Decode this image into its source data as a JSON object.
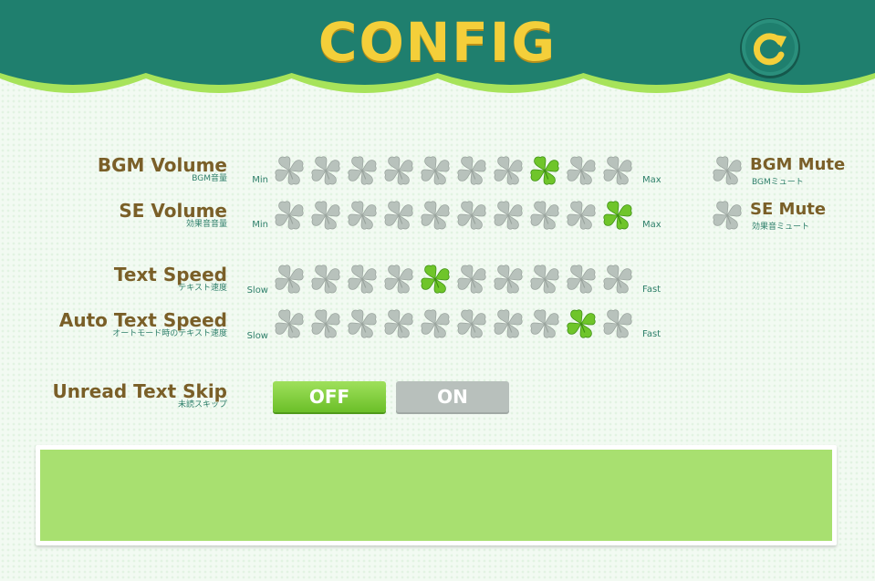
{
  "header": {
    "title": "CONFIG",
    "back_icon": "refresh-arrow-icon",
    "colors": {
      "band": "#1f7f6e",
      "trim": "#a7e35a",
      "title": "#f4cf3a"
    }
  },
  "settings": {
    "bgm_volume": {
      "label": "BGM Volume",
      "sublabel": "BGM音量",
      "min_label": "Min",
      "max_label": "Max",
      "selected": 8,
      "steps": 10
    },
    "se_volume": {
      "label": "SE Volume",
      "sublabel": "効果音音量",
      "min_label": "Min",
      "max_label": "Max",
      "selected": 10,
      "steps": 10
    },
    "text_speed": {
      "label": "Text Speed",
      "sublabel": "テキスト速度",
      "min_label": "Slow",
      "max_label": "Fast",
      "selected": 5,
      "steps": 10
    },
    "auto_text_speed": {
      "label": "Auto Text Speed",
      "sublabel": "オートモード時のテキスト速度",
      "min_label": "Slow",
      "max_label": "Fast",
      "selected": 9,
      "steps": 10
    },
    "unread_text_skip": {
      "label": "Unread Text Skip",
      "sublabel": "未読スキップ",
      "off_label": "OFF",
      "on_label": "ON",
      "value": "OFF"
    }
  },
  "mutes": {
    "bgm": {
      "label": "BGM Mute",
      "sublabel": "BGMミュート",
      "active": false
    },
    "se": {
      "label": "SE Mute",
      "sublabel": "効果音ミュート",
      "active": false
    }
  },
  "clover_colors": {
    "inactive": "#b8c2bc",
    "active": "#6fc52a"
  },
  "preview": {
    "color": "#a8e070"
  }
}
